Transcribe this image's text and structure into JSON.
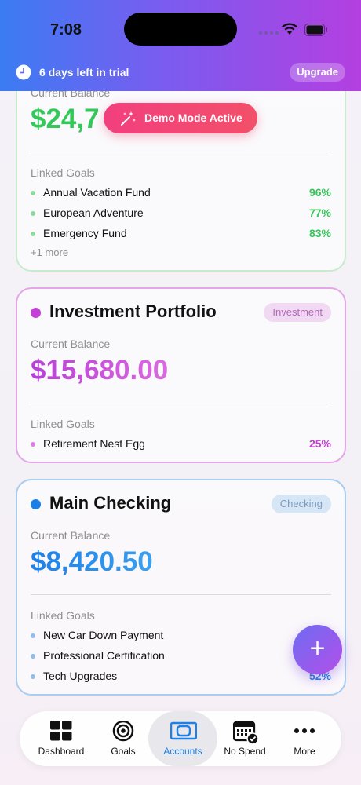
{
  "status_bar": {
    "time": "7:08"
  },
  "trial_bar": {
    "text": "6 days left in trial",
    "upgrade_label": "Upgrade"
  },
  "demo_banner": {
    "text": "Demo Mode Active"
  },
  "cards": [
    {
      "balance_label": "Current Balance",
      "balance": "$24,7",
      "goals_label": "Linked Goals",
      "goals": [
        {
          "name": "Annual Vacation Fund",
          "percent": "96%"
        },
        {
          "name": "European Adventure",
          "percent": "77%"
        },
        {
          "name": "Emergency Fund",
          "percent": "83%"
        }
      ],
      "more": "+1 more",
      "accent": "#34c759"
    },
    {
      "title": "Investment Portfolio",
      "type": "Investment",
      "balance_label": "Current Balance",
      "balance": "$15,680.00",
      "goals_label": "Linked Goals",
      "goals": [
        {
          "name": "Retirement Nest Egg",
          "percent": "25%"
        }
      ],
      "accent": "#c43fd6"
    },
    {
      "title": "Main Checking",
      "type": "Checking",
      "balance_label": "Current Balance",
      "balance": "$8,420.50",
      "goals_label": "Linked Goals",
      "goals": [
        {
          "name": "New Car Down Payment",
          "percent": ""
        },
        {
          "name": "Professional Certification",
          "percent": ""
        },
        {
          "name": "Tech Upgrades",
          "percent": "52%"
        }
      ],
      "accent": "#1a7fe6"
    }
  ],
  "fab": {
    "icon": "plus-icon",
    "label": "+"
  },
  "tab_bar": {
    "tabs": [
      {
        "label": "Dashboard",
        "icon": "grid-icon"
      },
      {
        "label": "Goals",
        "icon": "target-icon"
      },
      {
        "label": "Accounts",
        "icon": "card-icon",
        "active": true
      },
      {
        "label": "No Spend",
        "icon": "calendar-check-icon"
      },
      {
        "label": "More",
        "icon": "ellipsis-icon"
      }
    ]
  }
}
